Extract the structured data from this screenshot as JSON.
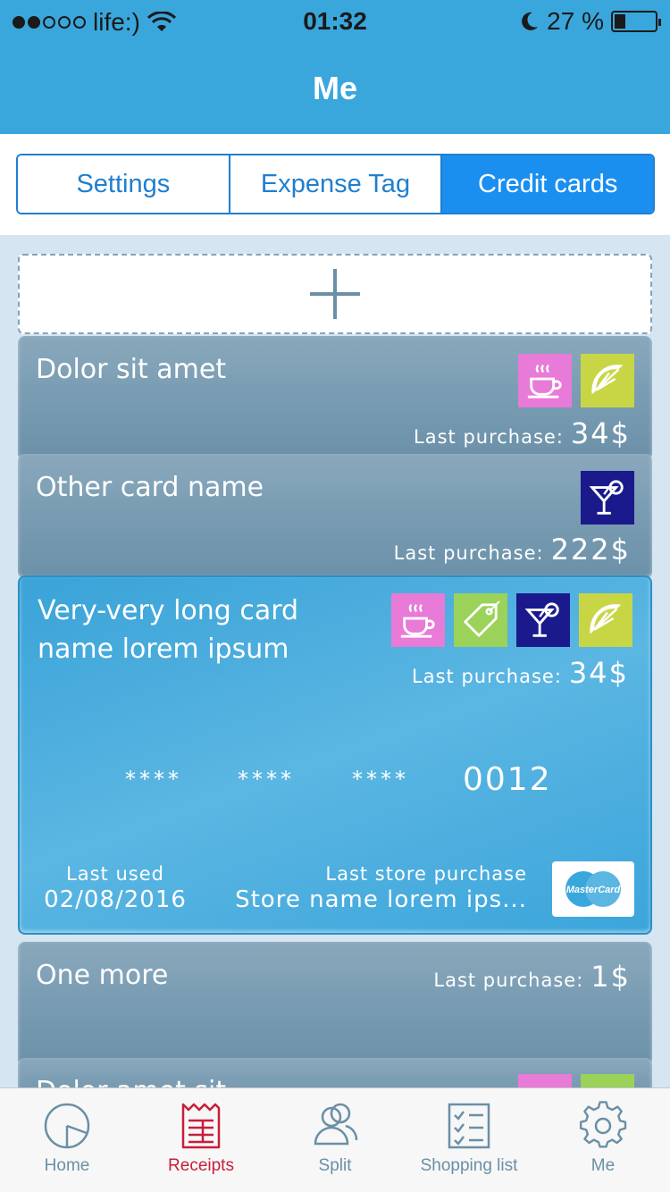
{
  "status_bar": {
    "carrier": "life:)",
    "time": "01:32",
    "battery": "27 %"
  },
  "nav": {
    "title": "Me"
  },
  "segment": {
    "items": [
      {
        "label": "Settings",
        "active": false
      },
      {
        "label": "Expense Tag",
        "active": false
      },
      {
        "label": "Credit cards",
        "active": true
      }
    ]
  },
  "cards": [
    {
      "name": "Dolor sit amet",
      "last_purchase_label": "Last purchase:",
      "last_purchase_amount": "34$",
      "tags": [
        "coffee-icon",
        "lemon-icon"
      ]
    },
    {
      "name": "Other card name",
      "last_purchase_label": "Last purchase:",
      "last_purchase_amount": "222$",
      "tags": [
        "cocktail-icon"
      ]
    },
    {
      "name_line1": "Very-very long card",
      "name_line2": "name lorem ipsum",
      "last_purchase_label": "Last purchase:",
      "last_purchase_amount": "34$",
      "tags": [
        "coffee-icon",
        "price-tag-icon",
        "cocktail-icon",
        "lemon-icon"
      ],
      "masked_groups": [
        "****",
        "****",
        "****"
      ],
      "last4": "0012",
      "last_used_label": "Last used",
      "last_used_value": "02/08/2016",
      "last_store_label": "Last store purchase",
      "last_store_value": "Store name lorem ips...",
      "brand": "MasterCard"
    },
    {
      "name": "One more",
      "last_purchase_label": "Last purchase:",
      "last_purchase_amount": "1$"
    },
    {
      "name": "Dolor amet sit"
    }
  ],
  "tabbar": {
    "items": [
      {
        "label": "Home",
        "icon": "pie-chart-icon",
        "active": false
      },
      {
        "label": "Receipts",
        "icon": "receipt-icon",
        "active": true
      },
      {
        "label": "Split",
        "icon": "users-icon",
        "active": false
      },
      {
        "label": "Shopping list",
        "icon": "checklist-icon",
        "active": false
      },
      {
        "label": "Me",
        "icon": "gear-icon",
        "active": false
      }
    ]
  },
  "colors": {
    "header": "#3aa7dc",
    "segment_active": "#1a8ff0",
    "tab_active": "#c81e3a",
    "tab_inactive": "#6a8fa6"
  }
}
